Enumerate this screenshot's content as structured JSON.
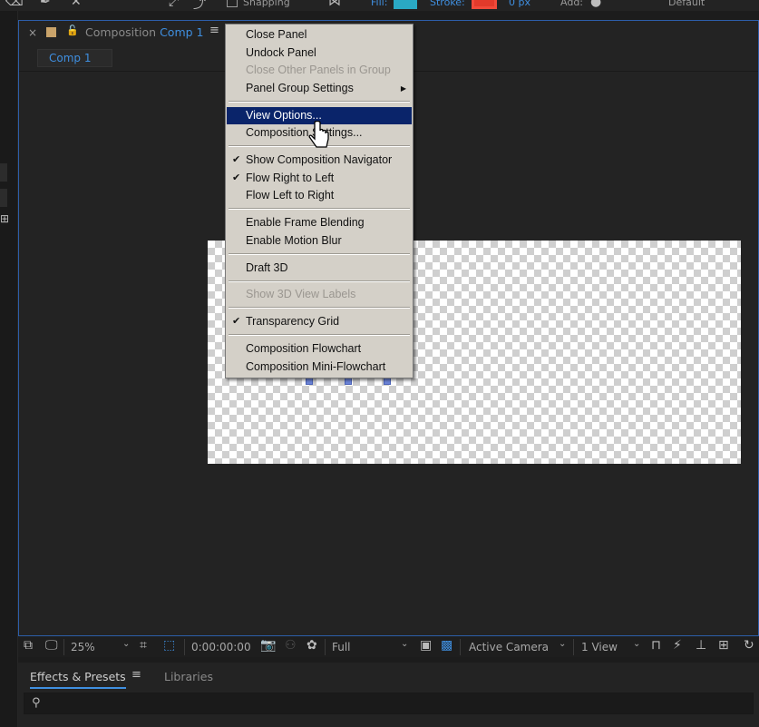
{
  "toolbar": {
    "snapping_label": "Snapping",
    "fill_label": "Fill:",
    "stroke_label": "Stroke:",
    "stroke_width": "0 px",
    "add_label": "Add:",
    "workspace": "Default"
  },
  "comp_panel": {
    "title_prefix": "Composition",
    "title_comp": "Comp 1",
    "subtab": "Comp 1"
  },
  "context_menu": {
    "items": [
      {
        "label": "Close Panel"
      },
      {
        "label": "Undock Panel"
      },
      {
        "label": "Close Other Panels in Group",
        "state": "disabled"
      },
      {
        "label": "Panel Group Settings",
        "submenu": true
      },
      {
        "label": "View Options...",
        "state": "highlighted"
      },
      {
        "label": "Composition Settings..."
      },
      {
        "label": "Show Composition Navigator",
        "checked": true
      },
      {
        "label": "Flow Right to Left",
        "checked": true
      },
      {
        "label": "Flow Left to Right"
      },
      {
        "label": "Enable Frame Blending"
      },
      {
        "label": "Enable Motion Blur"
      },
      {
        "label": "Draft 3D"
      },
      {
        "label": "Show 3D View Labels",
        "state": "disabled"
      },
      {
        "label": "Transparency Grid",
        "checked": true
      },
      {
        "label": "Composition Flowchart"
      },
      {
        "label": "Composition Mini-Flowchart"
      }
    ]
  },
  "viewer_bar": {
    "zoom": "25%",
    "timecode": "0:00:00:00",
    "resolution": "Full",
    "camera": "Active Camera",
    "views": "1 View"
  },
  "effects_panel": {
    "tab_effects": "Effects & Presets",
    "tab_libraries": "Libraries",
    "search_placeholder": ""
  },
  "colors": {
    "accent_blue": "#3f8fe0",
    "menu_highlight": "#0a246a",
    "menu_bg": "#d4d0c8",
    "fill_swatch": "#2aa9c4",
    "stroke_swatch": "#e23a2b",
    "panel_border": "#2d5eaa"
  }
}
